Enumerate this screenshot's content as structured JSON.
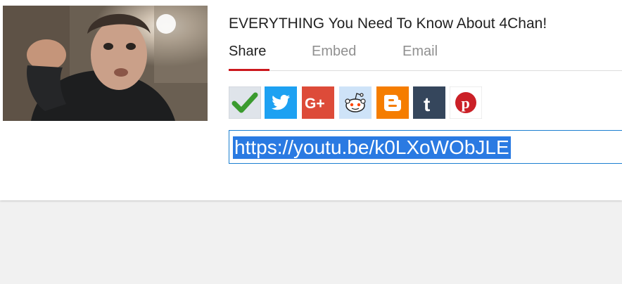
{
  "video": {
    "title": "EVERYTHING You Need To Know About 4Chan!"
  },
  "tabs": [
    {
      "label": "Share",
      "active": true
    },
    {
      "label": "Embed",
      "active": false
    },
    {
      "label": "Email",
      "active": false
    }
  ],
  "share_buttons": [
    {
      "name": "checkmark-share",
      "icon": "checkmark-icon"
    },
    {
      "name": "twitter",
      "icon": "twitter-bird-icon",
      "color": "#1da1f2"
    },
    {
      "name": "google-plus",
      "icon": "google-plus-icon",
      "color": "#dd4b39"
    },
    {
      "name": "reddit",
      "icon": "reddit-alien-icon",
      "color": "#cee3f8"
    },
    {
      "name": "blogger",
      "icon": "blogger-icon",
      "color": "#f57d00"
    },
    {
      "name": "tumblr",
      "icon": "tumblr-icon",
      "color": "#35465c"
    },
    {
      "name": "pinterest",
      "icon": "pinterest-icon",
      "color": "#cb2027"
    }
  ],
  "share_url": {
    "value": "https://youtu.be/k0LXoWObJLE",
    "selected": true
  },
  "colors": {
    "accent_red": "#cc181e",
    "selection_blue": "#2a7ae2",
    "field_border": "#1b7fd1"
  }
}
